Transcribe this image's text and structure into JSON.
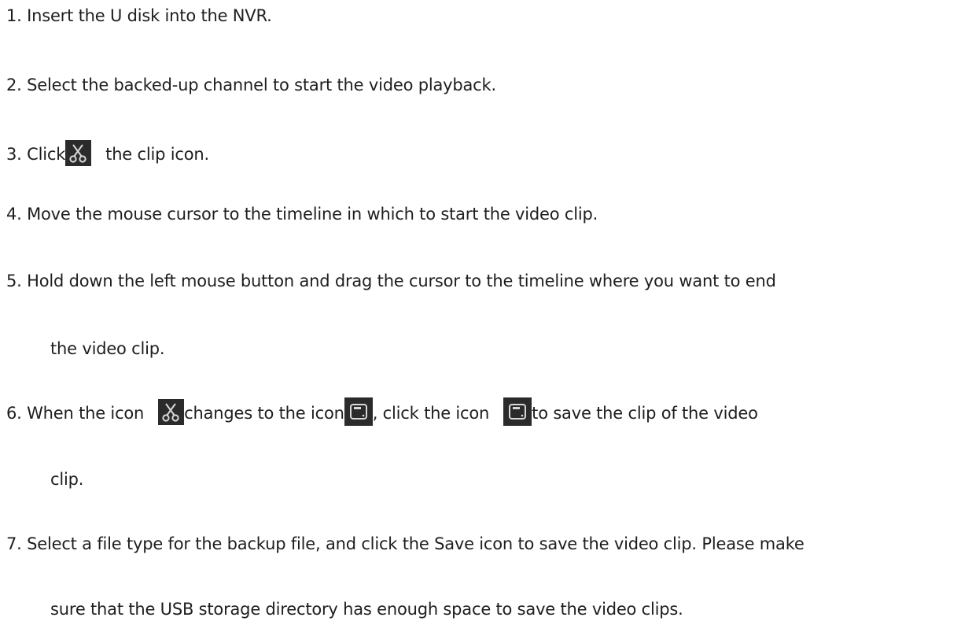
{
  "steps": [
    {
      "text": "1.  Insert the U disk into the NVR."
    },
    {
      "text": "2.  Select the backed-up channel to start the video playback."
    },
    {
      "prefix": "3.  Click",
      "suffix": "the clip icon.",
      "icon": "scissors-icon"
    },
    {
      "text": "4.  Move the mouse cursor to the timeline in which to start the video clip."
    },
    {
      "text": "5.  Hold down the left mouse button and drag the cursor to the timeline where you want to end",
      "continuation": "the video clip."
    },
    {
      "part1": "6.  When the icon",
      "part2": "changes to the icon",
      "part3": ", click the icon",
      "part4": "to save the clip of the video",
      "continuation": "clip.",
      "icons": [
        "scissors-icon",
        "save-icon",
        "save-icon"
      ]
    },
    {
      "text": "7.  Select a file type for the backup file, and click the Save icon to save the video clip. Please make",
      "continuation": "sure that the USB storage directory has enough space to save the video clips."
    }
  ],
  "colors": {
    "text": "#1e1e1e",
    "icon_bg": "#2b2b2b",
    "icon_fg": "#d9d9d9"
  }
}
